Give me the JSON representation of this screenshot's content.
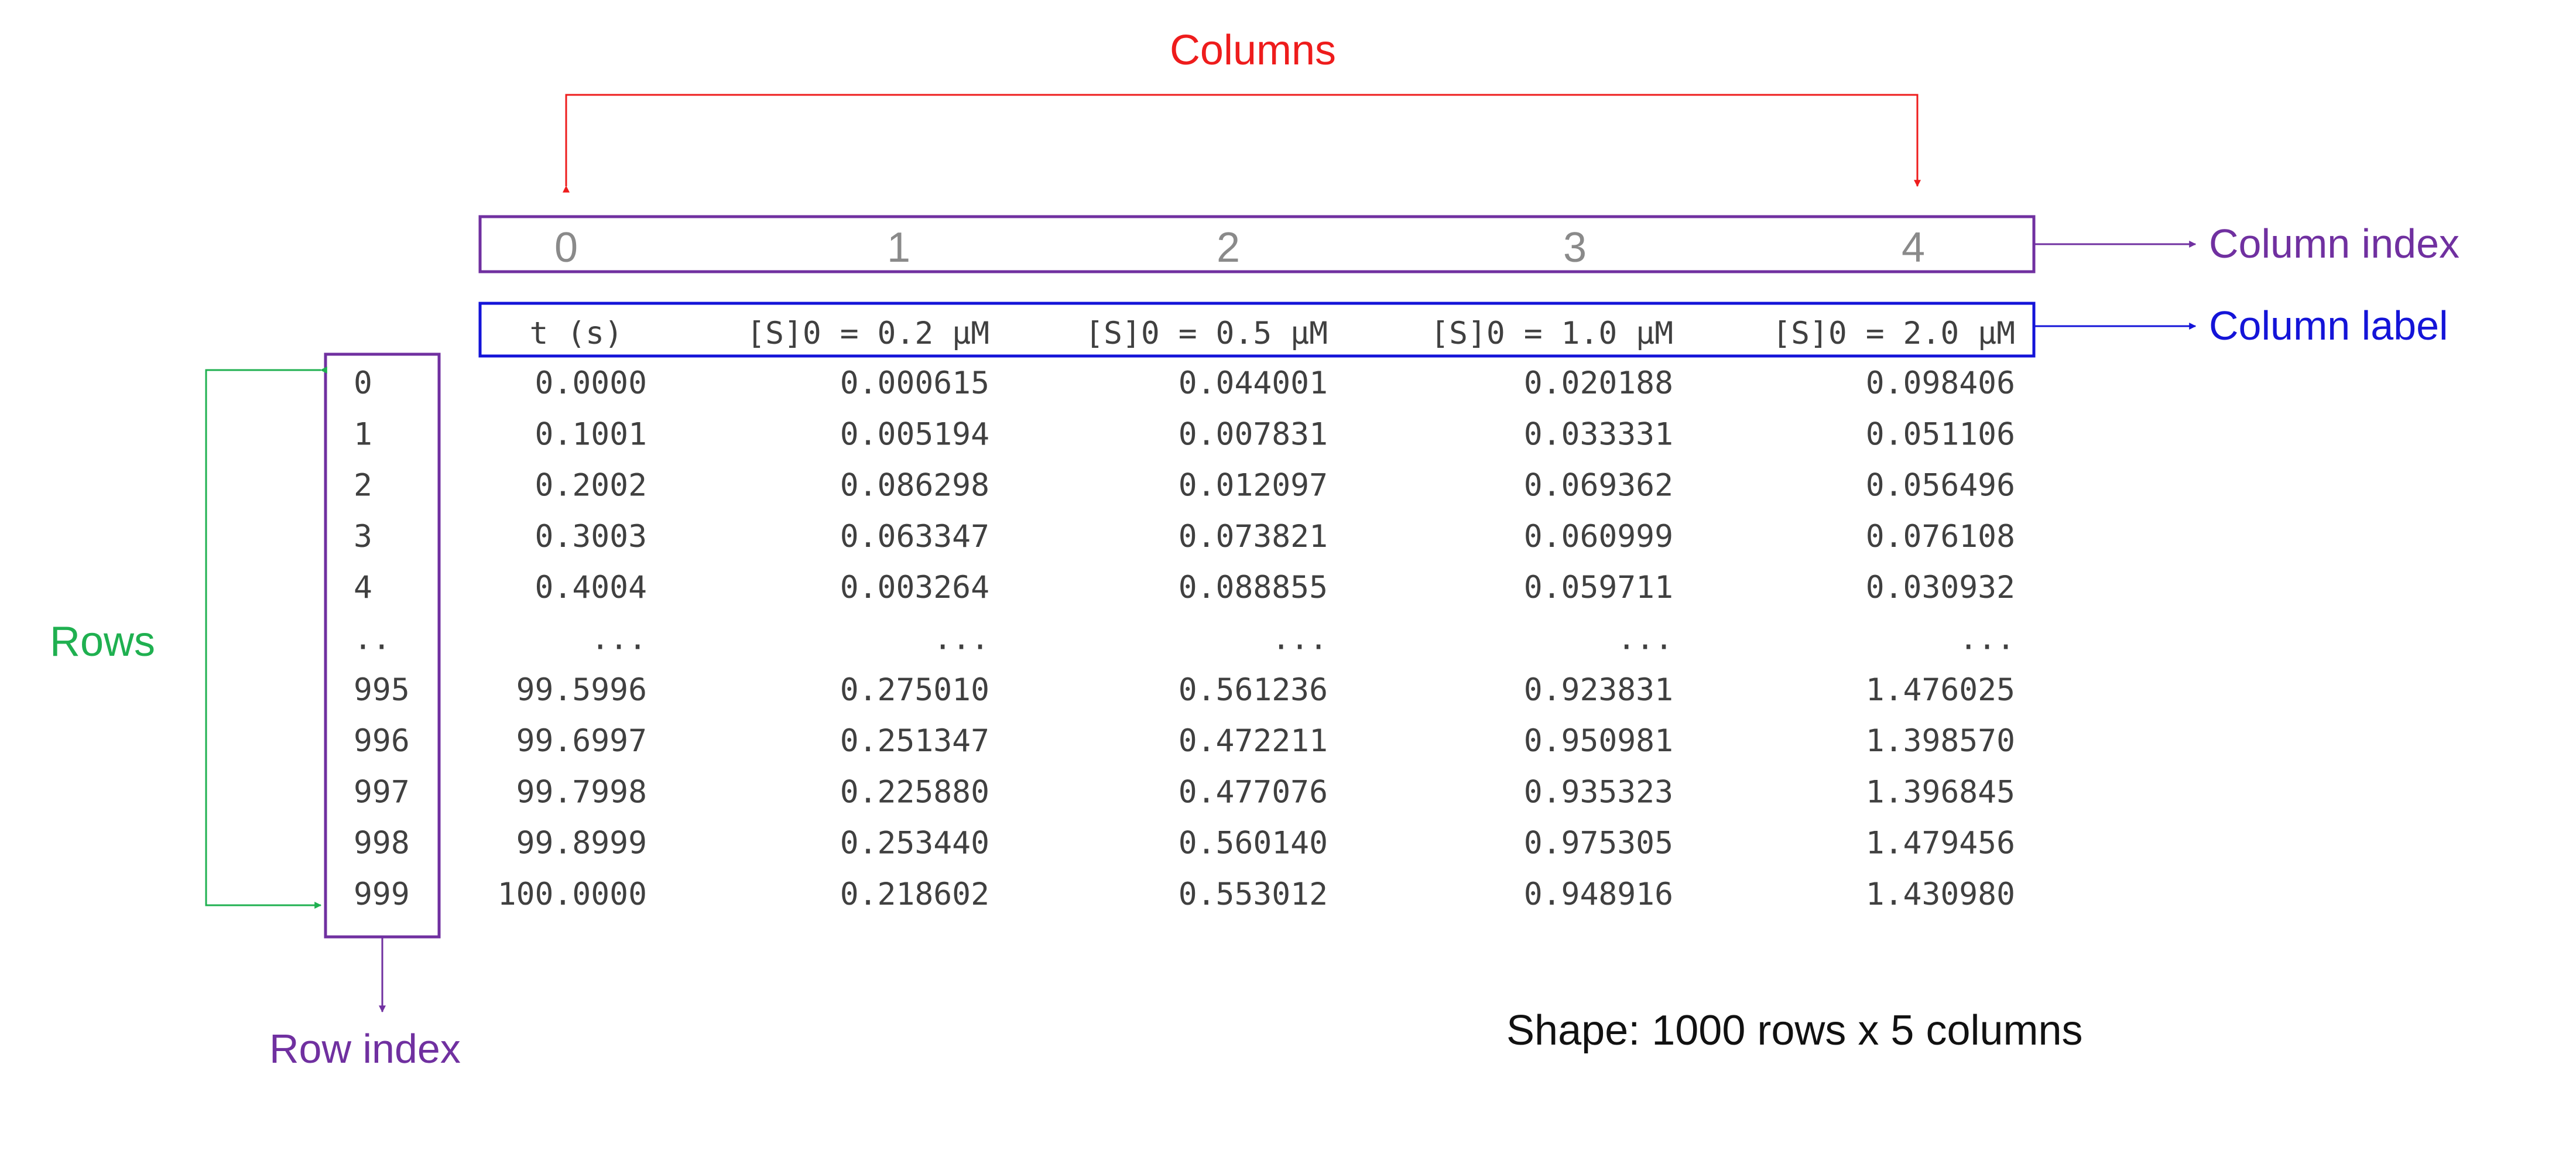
{
  "annotations": {
    "columns": "Columns",
    "rows": "Rows",
    "column_index": "Column index",
    "column_label": "Column label",
    "row_index": "Row index",
    "shape": "Shape: 1000 rows x 5 columns"
  },
  "column_index": [
    "0",
    "1",
    "2",
    "3",
    "4"
  ],
  "column_labels": [
    "t (s)",
    "[S]0 = 0.2 μM",
    "[S]0 = 0.5 μM",
    "[S]0 = 1.0 μM",
    "[S]0 = 2.0 μM"
  ],
  "row_index": [
    "0",
    "1",
    "2",
    "3",
    "4",
    "..",
    "995",
    "996",
    "997",
    "998",
    "999"
  ],
  "rows": [
    [
      "0.0000",
      "0.000615",
      "0.044001",
      "0.020188",
      "0.098406"
    ],
    [
      "0.1001",
      "0.005194",
      "0.007831",
      "0.033331",
      "0.051106"
    ],
    [
      "0.2002",
      "0.086298",
      "0.012097",
      "0.069362",
      "0.056496"
    ],
    [
      "0.3003",
      "0.063347",
      "0.073821",
      "0.060999",
      "0.076108"
    ],
    [
      "0.4004",
      "0.003264",
      "0.088855",
      "0.059711",
      "0.030932"
    ],
    [
      "...",
      "...",
      "...",
      "...",
      "..."
    ],
    [
      "99.5996",
      "0.275010",
      "0.561236",
      "0.923831",
      "1.476025"
    ],
    [
      "99.6997",
      "0.251347",
      "0.472211",
      "0.950981",
      "1.398570"
    ],
    [
      "99.7998",
      "0.225880",
      "0.477076",
      "0.935323",
      "1.396845"
    ],
    [
      "99.8999",
      "0.253440",
      "0.560140",
      "0.975305",
      "1.479456"
    ],
    [
      "100.0000",
      "0.218602",
      "0.553012",
      "0.948916",
      "1.430980"
    ]
  ],
  "colors": {
    "columns": "#ee1c1c",
    "rows": "#1fb050",
    "index": "#7030a0",
    "label": "#1414d8",
    "index_text": "#8a8a8a",
    "cell_text": "#404040",
    "shape_text": "#111111"
  }
}
